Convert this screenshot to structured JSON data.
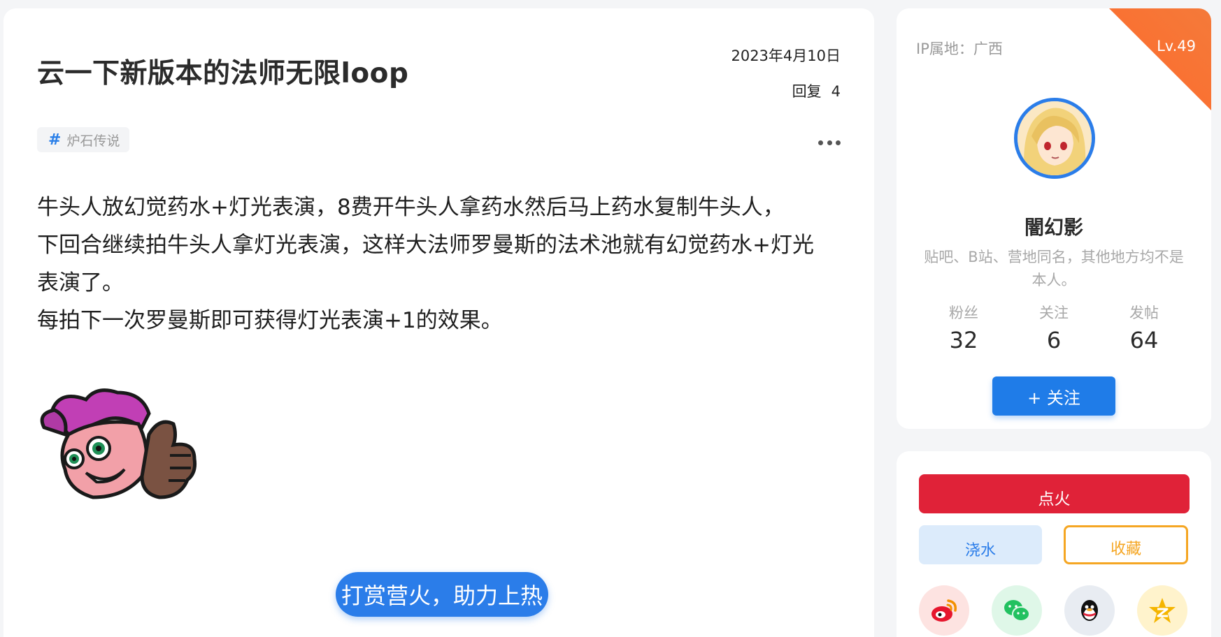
{
  "post": {
    "title": "云一下新版本的法师无限loop",
    "date": "2023年4月10日",
    "replies_label": "回复",
    "replies_count": "4",
    "tag": "炉石传说",
    "body": [
      "牛头人放幻觉药水+灯光表演，8费开牛头人拿药水然后马上药水复制牛头人，",
      "下回合继续拍牛头人拿灯光表演，这样大法师罗曼斯的法术池就有幻觉药水+灯光",
      "表演了。",
      "每拍下一次罗曼斯即可获得灯光表演+1的效果。"
    ],
    "reward_button": "打赏营火，助力上热"
  },
  "profile": {
    "ip_location": "IP属地：广西",
    "level": "Lv.49",
    "username": "闇幻影",
    "bio": "贴吧、B站、营地同名，其他地方均不是本人。",
    "stats": [
      {
        "label": "粉丝",
        "value": "32"
      },
      {
        "label": "关注",
        "value": "6"
      },
      {
        "label": "发帖",
        "value": "64"
      }
    ],
    "follow_button": "+ 关注"
  },
  "actions": {
    "fire": "点火",
    "water": "浇水",
    "collect": "收藏"
  },
  "share": [
    "weibo-icon",
    "wechat-icon",
    "qq-icon",
    "qzone-icon"
  ],
  "colors": {
    "accent_blue": "#2b7de9",
    "fire_red": "#e02238",
    "level_orange": "#ff6a2b",
    "collect_orange": "#f5a623"
  }
}
